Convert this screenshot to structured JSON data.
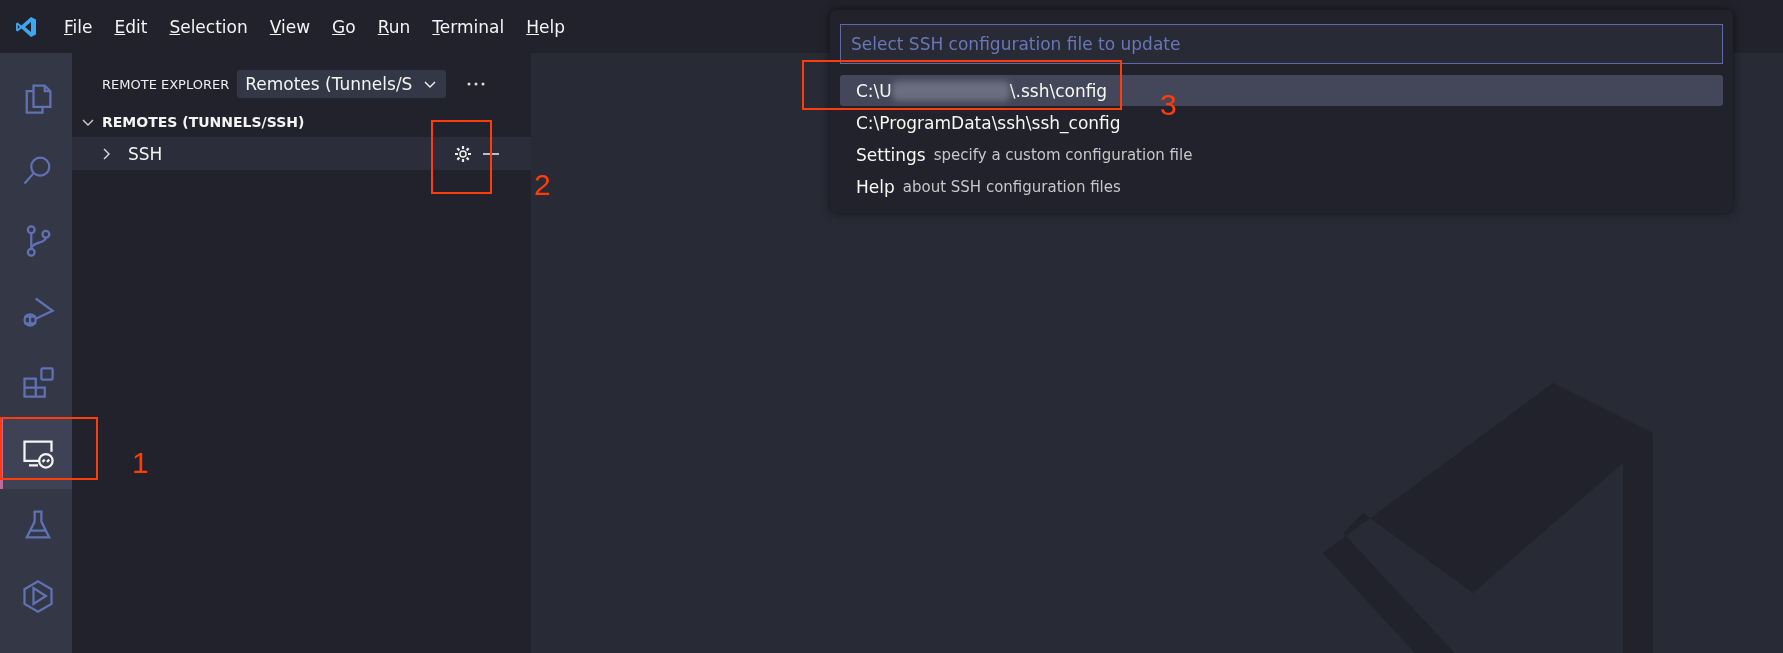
{
  "menu": [
    "File",
    "Edit",
    "Selection",
    "View",
    "Go",
    "Run",
    "Terminal",
    "Help"
  ],
  "activity_bar": [
    {
      "selected": false
    },
    {
      "selected": false
    },
    {
      "selected": false
    },
    {
      "selected": false
    },
    {
      "selected": false
    },
    {
      "selected": true
    },
    {
      "selected": false
    },
    {
      "selected": false
    }
  ],
  "sidebar": {
    "title": "REMOTE EXPLORER",
    "dropdown": "Remotes (Tunnels/S",
    "section": {
      "title": "REMOTES (TUNNELS/SSH)",
      "expanded": true
    },
    "items": [
      {
        "label": "SSH",
        "expanded": false
      }
    ]
  },
  "quick_pick": {
    "placeholder": "Select SSH configuration file to update",
    "items": [
      {
        "label": "C:\\U",
        "blurred": true,
        "label_end": "\\.ssh\\config",
        "selected": true
      },
      {
        "label": "C:\\ProgramData\\ssh\\ssh_config",
        "selected": false
      },
      {
        "label": "Settings",
        "description": "specify a custom configuration file",
        "selected": false
      },
      {
        "label": "Help",
        "description": "about SSH configuration files",
        "selected": false
      }
    ]
  },
  "annotations": [
    {
      "label": "1"
    },
    {
      "label": "2"
    },
    {
      "label": "3"
    }
  ]
}
